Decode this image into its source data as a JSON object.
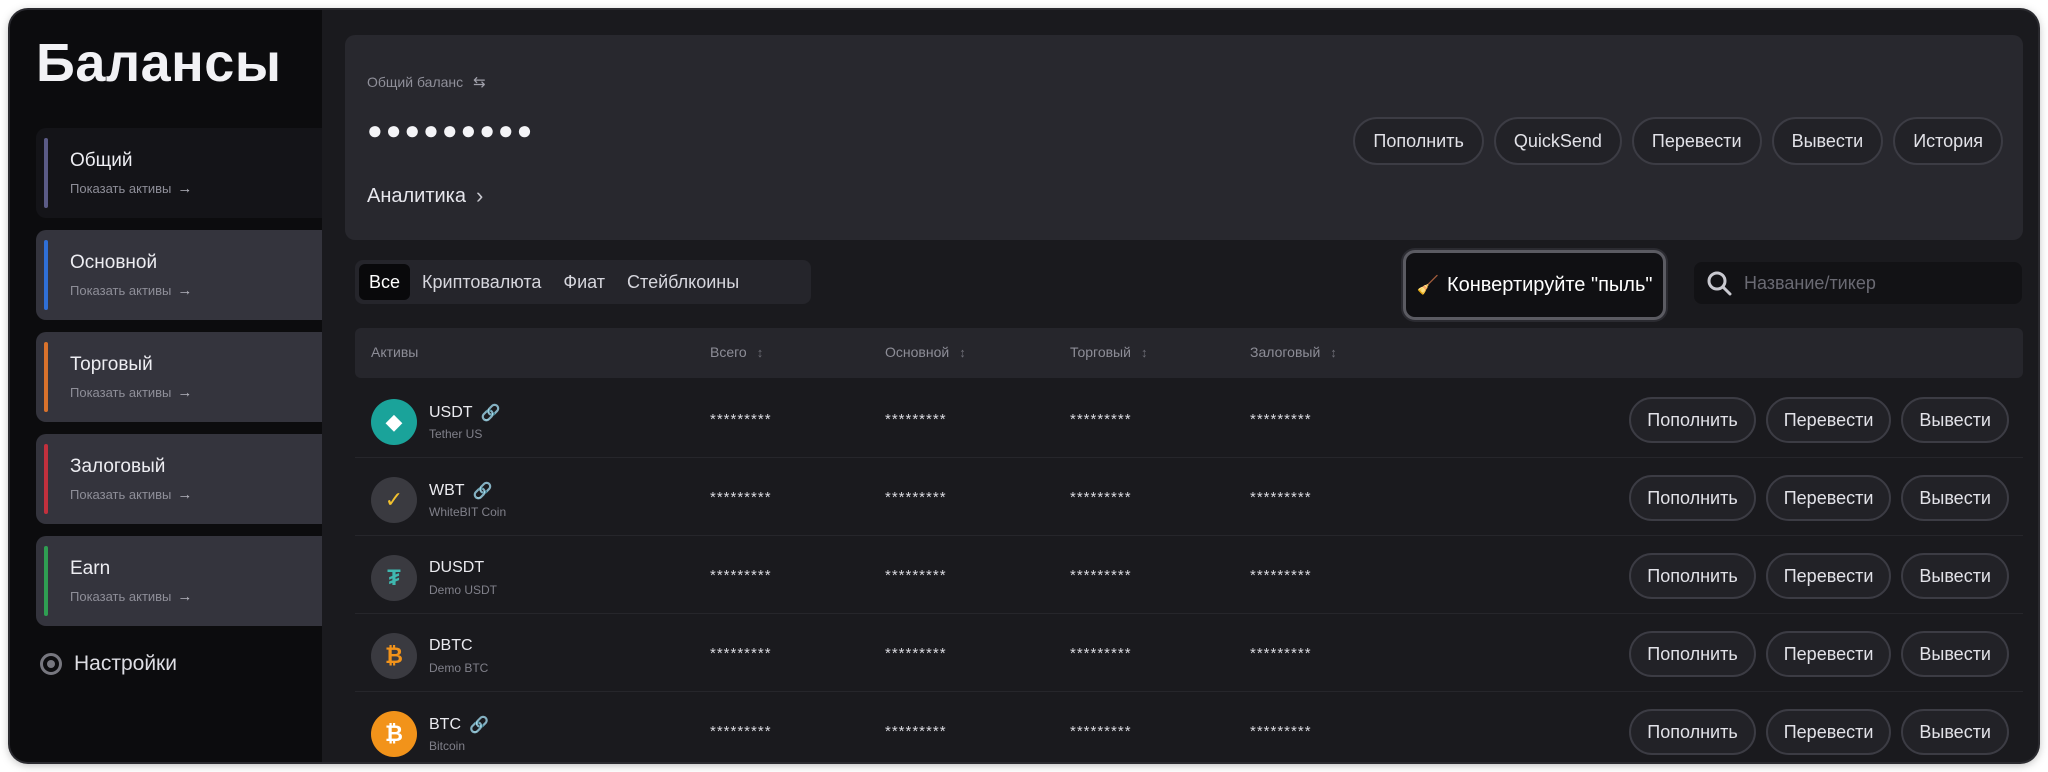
{
  "page_title": "Балансы",
  "accounts": [
    {
      "name": "Общий",
      "sub": "Показать активы",
      "color": "#5b5b86"
    },
    {
      "name": "Основной",
      "sub": "Показать активы",
      "color": "#2f6fd6"
    },
    {
      "name": "Торговый",
      "sub": "Показать активы",
      "color": "#d9722c"
    },
    {
      "name": "Залоговый",
      "sub": "Показать активы",
      "color": "#c2303d"
    },
    {
      "name": "Earn",
      "sub": "Показать активы",
      "color": "#2f9e52"
    }
  ],
  "settings_label": "Настройки",
  "balance": {
    "label": "Общий баланс",
    "hidden_value": "●●●●●●●●●",
    "analytics_label": "Аналитика"
  },
  "top_actions": [
    "Пополнить",
    "QuickSend",
    "Перевести",
    "Вывести",
    "История"
  ],
  "filters": [
    {
      "label": "Все",
      "active": true
    },
    {
      "label": "Криптовалюта",
      "active": false
    },
    {
      "label": "Фиат",
      "active": false
    },
    {
      "label": "Стейблкоины",
      "active": false
    }
  ],
  "dust_button_label": "Конвертируйте \"пыль\"",
  "search_placeholder": "Название/тикер",
  "table_headers": [
    "Активы",
    "Всего",
    "Основной",
    "Торговый",
    "Залоговый"
  ],
  "hidden_cell": "*********",
  "row_actions": [
    "Пополнить",
    "Перевести",
    "Вывести"
  ],
  "assets": [
    {
      "ticker": "USDT",
      "name": "Tether US",
      "icon_color": "#1aa39a",
      "glyph": "◆",
      "link": true
    },
    {
      "ticker": "WBT",
      "name": "WhiteBIT Coin",
      "icon_color": "#3a3a40",
      "glyph": "✓",
      "link": true
    },
    {
      "ticker": "DUSDT",
      "name": "Demo USDT",
      "icon_color": "#3a3a40",
      "glyph": "₮",
      "link": false
    },
    {
      "ticker": "DBTC",
      "name": "Demo BTC",
      "icon_color": "#3a3a40",
      "glyph": "₿",
      "link": false
    },
    {
      "ticker": "BTC",
      "name": "Bitcoin",
      "icon_color": "#f2931a",
      "glyph": "₿",
      "link": true
    }
  ]
}
